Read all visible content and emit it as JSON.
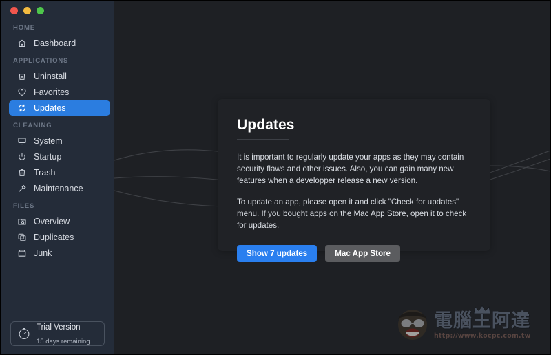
{
  "window": {
    "traffic_lights": [
      {
        "name": "close",
        "color": "#f1564d"
      },
      {
        "name": "minimize",
        "color": "#f3bb40"
      },
      {
        "name": "zoom",
        "color": "#4ec64b"
      }
    ]
  },
  "sidebar": {
    "sections": [
      {
        "label": "HOME",
        "items": [
          {
            "label": "Dashboard",
            "icon": "home-icon",
            "active": false
          }
        ]
      },
      {
        "label": "APPLICATIONS",
        "items": [
          {
            "label": "Uninstall",
            "icon": "uninstall-bin-icon",
            "active": false
          },
          {
            "label": "Favorites",
            "icon": "heart-icon",
            "active": false
          },
          {
            "label": "Updates",
            "icon": "refresh-icon",
            "active": true
          }
        ]
      },
      {
        "label": "CLEANING",
        "items": [
          {
            "label": "System",
            "icon": "monitor-icon",
            "active": false
          },
          {
            "label": "Startup",
            "icon": "power-icon",
            "active": false
          },
          {
            "label": "Trash",
            "icon": "trash-icon",
            "active": false
          },
          {
            "label": "Maintenance",
            "icon": "hammer-icon",
            "active": false
          }
        ]
      },
      {
        "label": "FILES",
        "items": [
          {
            "label": "Overview",
            "icon": "folder-search-icon",
            "active": false
          },
          {
            "label": "Duplicates",
            "icon": "copy-icon",
            "active": false
          },
          {
            "label": "Junk",
            "icon": "box-icon",
            "active": false
          }
        ]
      }
    ],
    "trial": {
      "icon": "timer-icon",
      "title": "Trial Version",
      "subtitle": "15 days remaining"
    },
    "accent_color": "#2b7de0",
    "background_color": "#242c39"
  },
  "main": {
    "background_color": "#1e2024",
    "card": {
      "title": "Updates",
      "paragraphs": [
        "It is important to regularly update your apps as they may contain security flaws and other issues. Also, you can gain many new features when a developper release a new version.",
        "To update an app, please open it and click \"Check for updates\" menu. If you bought apps on the Mac App Store, open it to check for updates."
      ],
      "buttons": [
        {
          "label": "Show 7 updates",
          "style": "primary",
          "color": "#2a7fef"
        },
        {
          "label": "Mac App Store",
          "style": "secondary",
          "color": "#5b5c5f"
        }
      ]
    }
  },
  "watermark": {
    "text": "電腦王阿達",
    "url": "http://www.kocpc.com.tw"
  }
}
